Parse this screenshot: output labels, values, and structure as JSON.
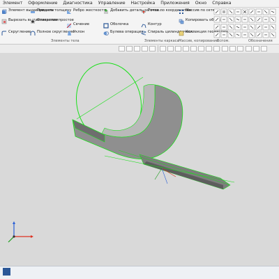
{
  "menu": [
    "Элемент",
    "Оформление",
    "Диагностика",
    "Управление",
    "Настройка",
    "Приложения",
    "Окно",
    "Справка"
  ],
  "ribbon": {
    "col1": [
      "Элемент выдавливания",
      "Вырезать выдавливанием",
      "Скругление"
    ],
    "col2": [
      "Придать толщину",
      "Отверстие простое",
      "Полное скругление"
    ],
    "col3": [
      "Ребро жесткости",
      "Сечение",
      "Уклон"
    ],
    "col4": [
      "Добавить деталь-заготов...",
      "Оболочка",
      "Булева операция"
    ],
    "col5": [
      "Точка по координатам",
      "Контур",
      "Спираль цилиндрическ..."
    ],
    "col6": [
      "Массив по сетке",
      "Копировать объекты",
      "Коллекция геометрии"
    ],
    "group_labels": [
      "Элементы тела",
      "Элементы каркаса",
      "Массив, копирование",
      "Вспом.",
      "Обозначения"
    ]
  },
  "taskbar": {
    "start_icon": "windows-start-icon"
  },
  "colors": {
    "accent_green": "#19e019",
    "model_gray": "#9a9a9a",
    "viewport_bg": "#d9d9d9"
  }
}
